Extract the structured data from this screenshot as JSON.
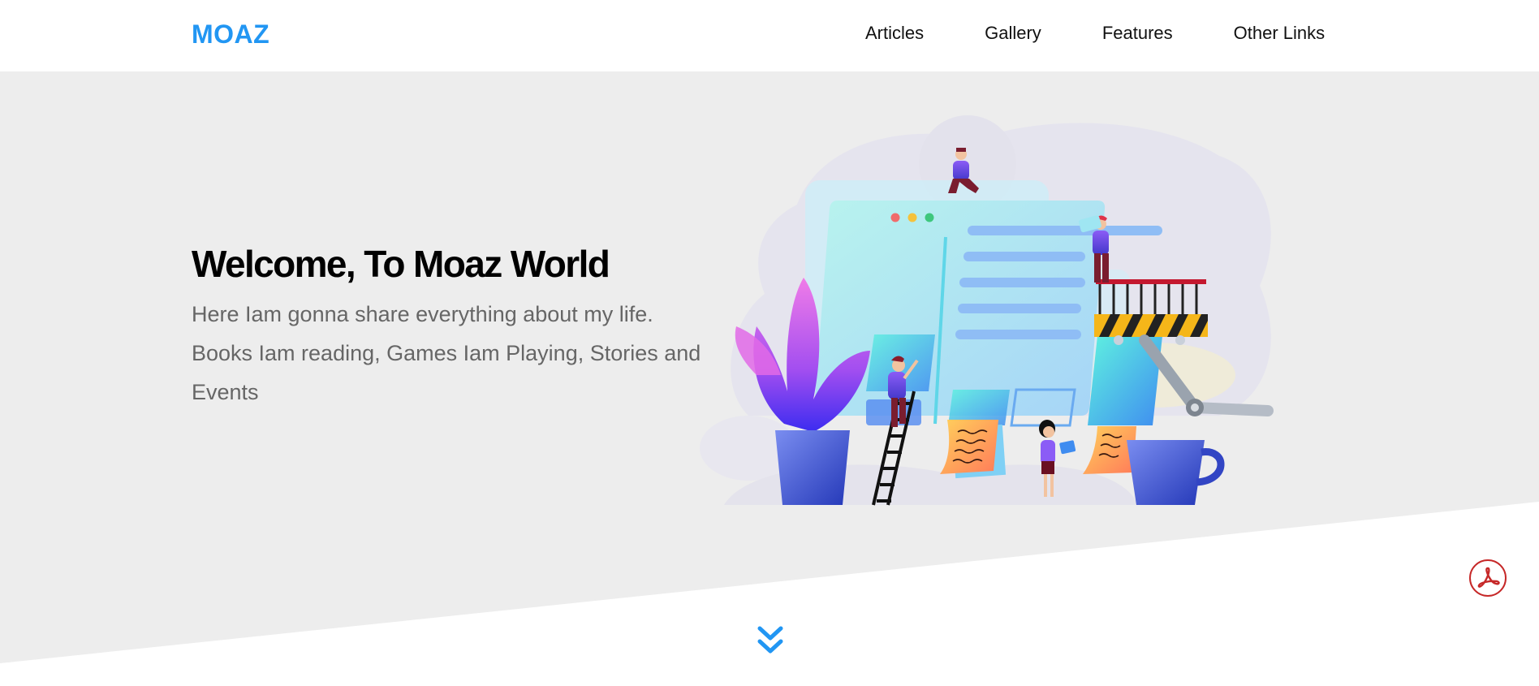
{
  "header": {
    "logo": "MOAZ",
    "nav": [
      {
        "label": "Articles"
      },
      {
        "label": "Gallery"
      },
      {
        "label": "Features"
      },
      {
        "label": "Other Links"
      }
    ]
  },
  "hero": {
    "title": "Welcome, To Moaz World",
    "description": "Here Iam gonna share everything about my life. Books Iam reading, Games Iam Playing, Stories and Events",
    "illustration_icon": "website-construction-illustration",
    "scroll_icon": "double-chevron-down-icon"
  },
  "floating": {
    "pdf_icon": "acrobat-pdf-icon"
  },
  "colors": {
    "accent": "#2196f3",
    "hero_background": "#ededed",
    "body_background": "#ffffff",
    "title_text": "#000000",
    "description_text": "#666666",
    "pdf_red": "#c62828"
  }
}
